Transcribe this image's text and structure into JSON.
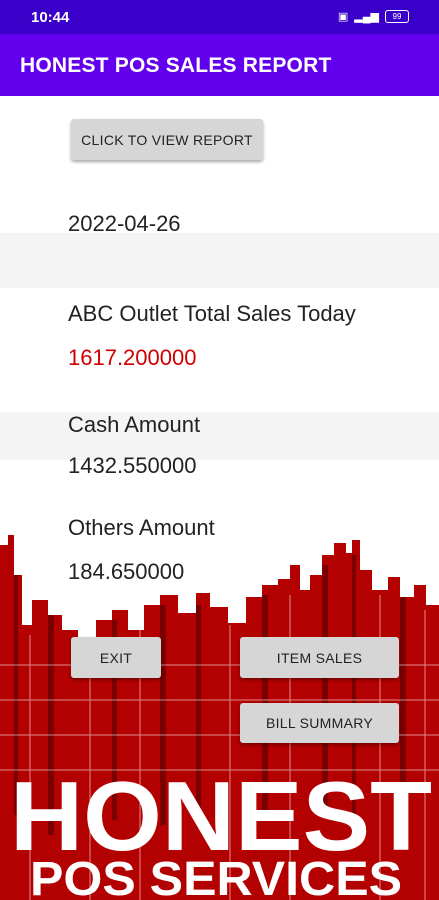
{
  "status_bar": {
    "time": "10:44",
    "battery": "99"
  },
  "app_bar": {
    "title": "HONEST POS SALES REPORT"
  },
  "buttons": {
    "view_report": "CLICK TO VIEW REPORT",
    "exit": "EXIT",
    "item_sales": "ITEM SALES",
    "bill_summary": "BILL SUMMARY"
  },
  "report": {
    "date": "2022-04-26",
    "total_label": "ABC Outlet Total Sales Today",
    "total_value": "1617.200000",
    "cash_label": "Cash Amount",
    "cash_value": "1432.550000",
    "others_label": "Others Amount",
    "others_value": "184.650000"
  },
  "brand": {
    "line1": "HONEST",
    "line2": "POS SERVICES"
  },
  "colors": {
    "status_bar": "#3a00c9",
    "app_bar": "#6200ee",
    "total_value": "#d00000",
    "city": "#b30000"
  }
}
